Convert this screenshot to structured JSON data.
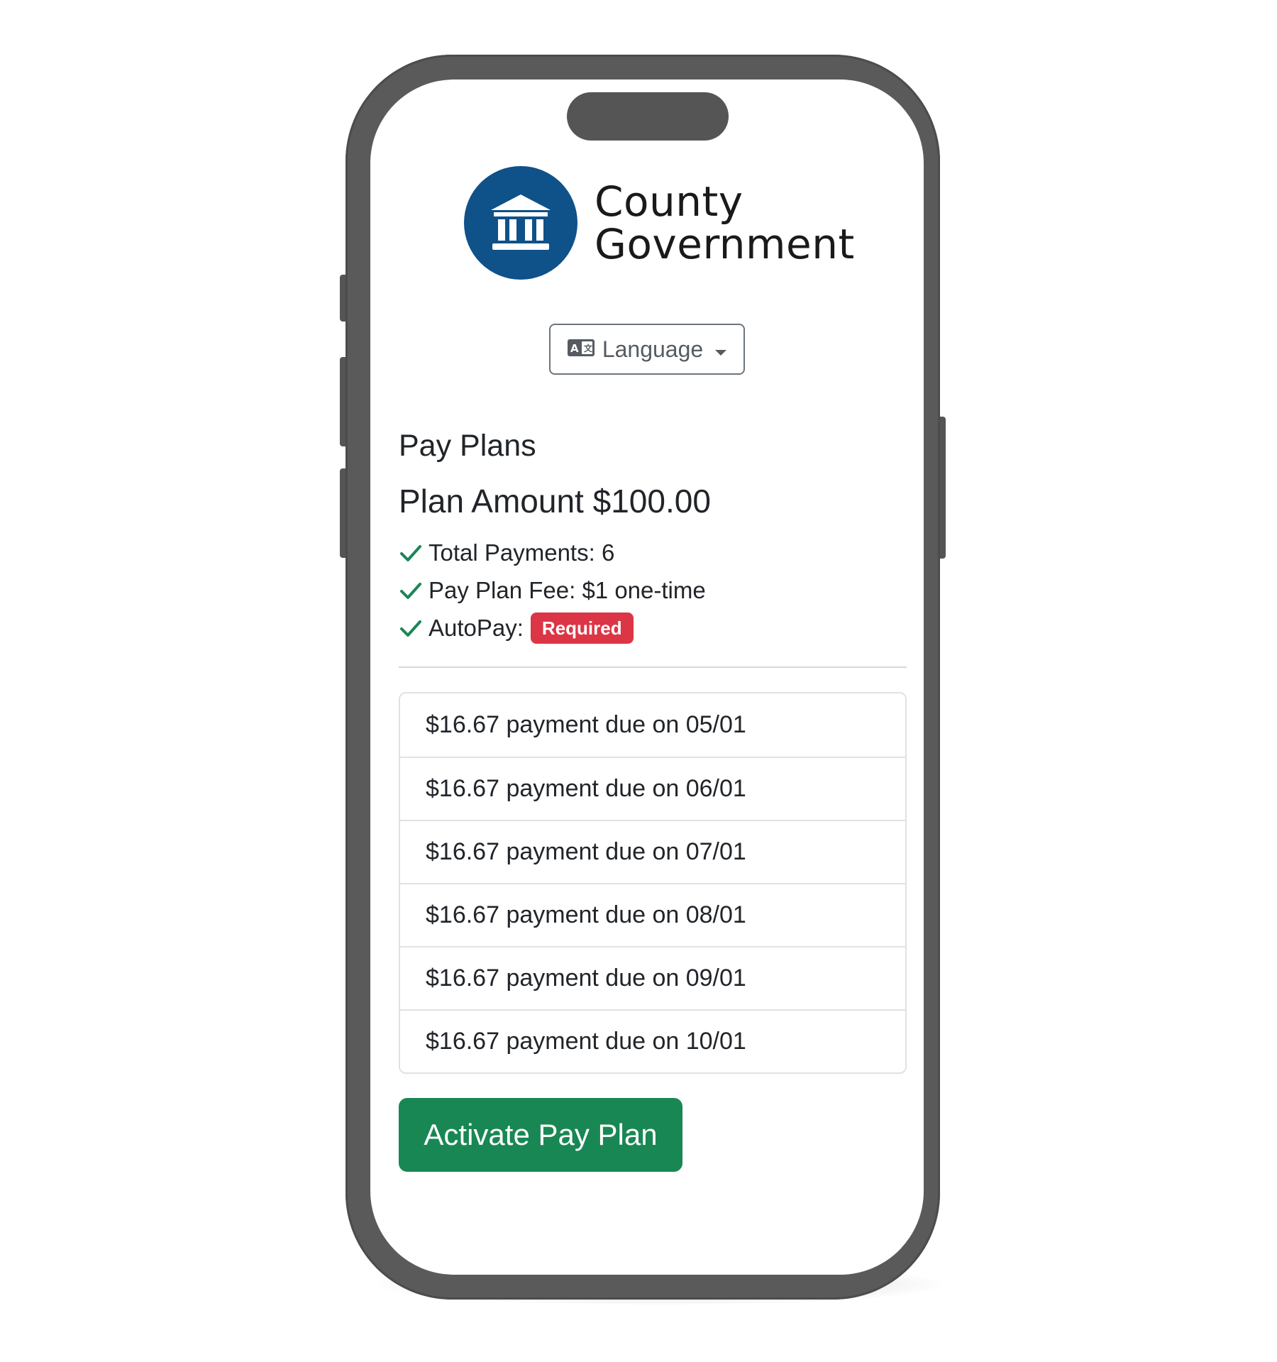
{
  "brand": {
    "logo_icon": "courthouse-icon",
    "name_line1": "County",
    "name_line2": "Government",
    "logo_color": "#0f5189"
  },
  "language": {
    "icon": "translate-icon",
    "label": "Language",
    "caret_icon": "caret-down-icon"
  },
  "plan": {
    "title": "Pay Plans",
    "amount_label": "Plan Amount $100.00",
    "features": [
      {
        "icon": "check-icon",
        "text": "Total Payments: 6"
      },
      {
        "icon": "check-icon",
        "text": "Pay Plan Fee: $1 one-time"
      },
      {
        "icon": "check-icon",
        "text": "AutoPay:",
        "badge": "Required"
      }
    ],
    "schedule": [
      "$16.67 payment due on 05/01",
      "$16.67 payment due on 06/01",
      "$16.67 payment due on 07/01",
      "$16.67 payment due on 08/01",
      "$16.67 payment due on 09/01",
      "$16.67 payment due on 10/01"
    ],
    "activate_label": "Activate Pay Plan"
  },
  "colors": {
    "accent_green": "#198754",
    "badge_red": "#dc3545",
    "check_green": "#198754",
    "phone_frame": "#5a5a5a"
  }
}
